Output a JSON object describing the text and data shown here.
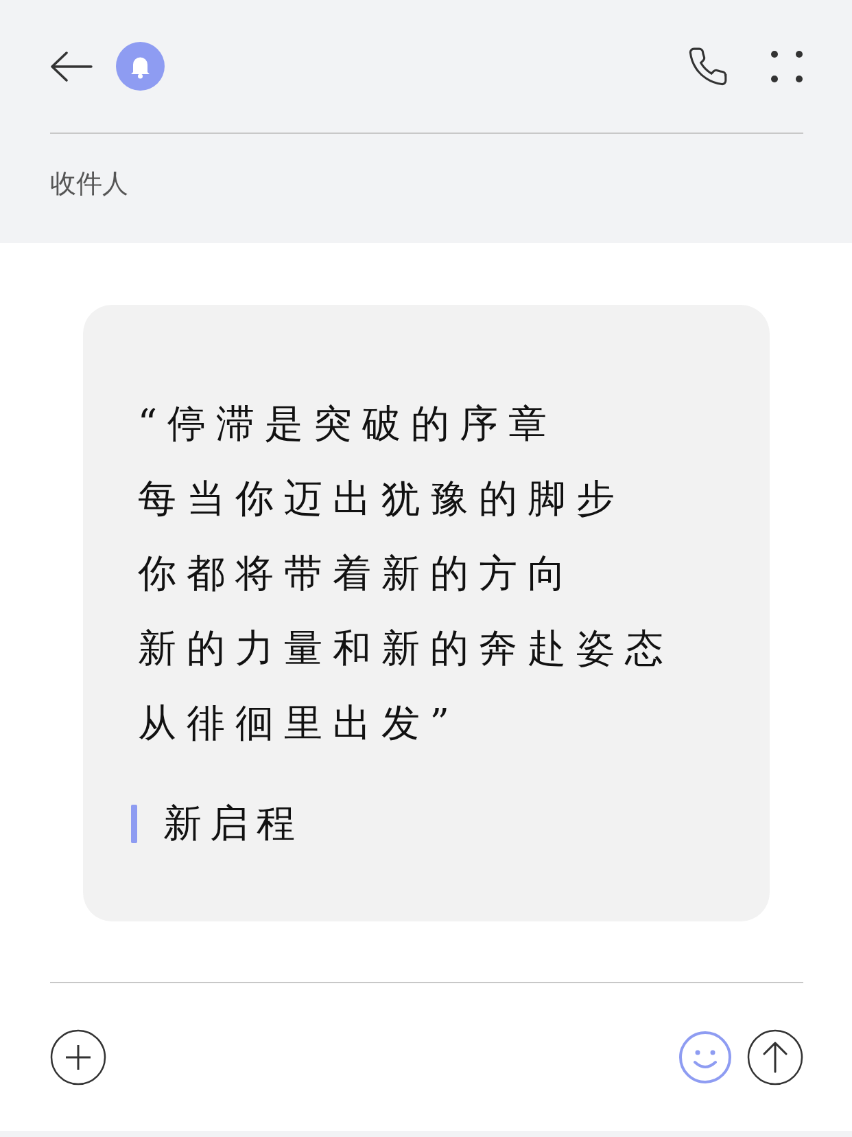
{
  "header": {
    "recipient_label": "收件人"
  },
  "message": {
    "lines": [
      "“停滞是突破的序章",
      "每当你迈出犹豫的脚步",
      "你都将带着新的方向",
      "新的力量和新的奔赴姿态",
      "从徘徊里出发”"
    ],
    "signature": "新启程"
  }
}
